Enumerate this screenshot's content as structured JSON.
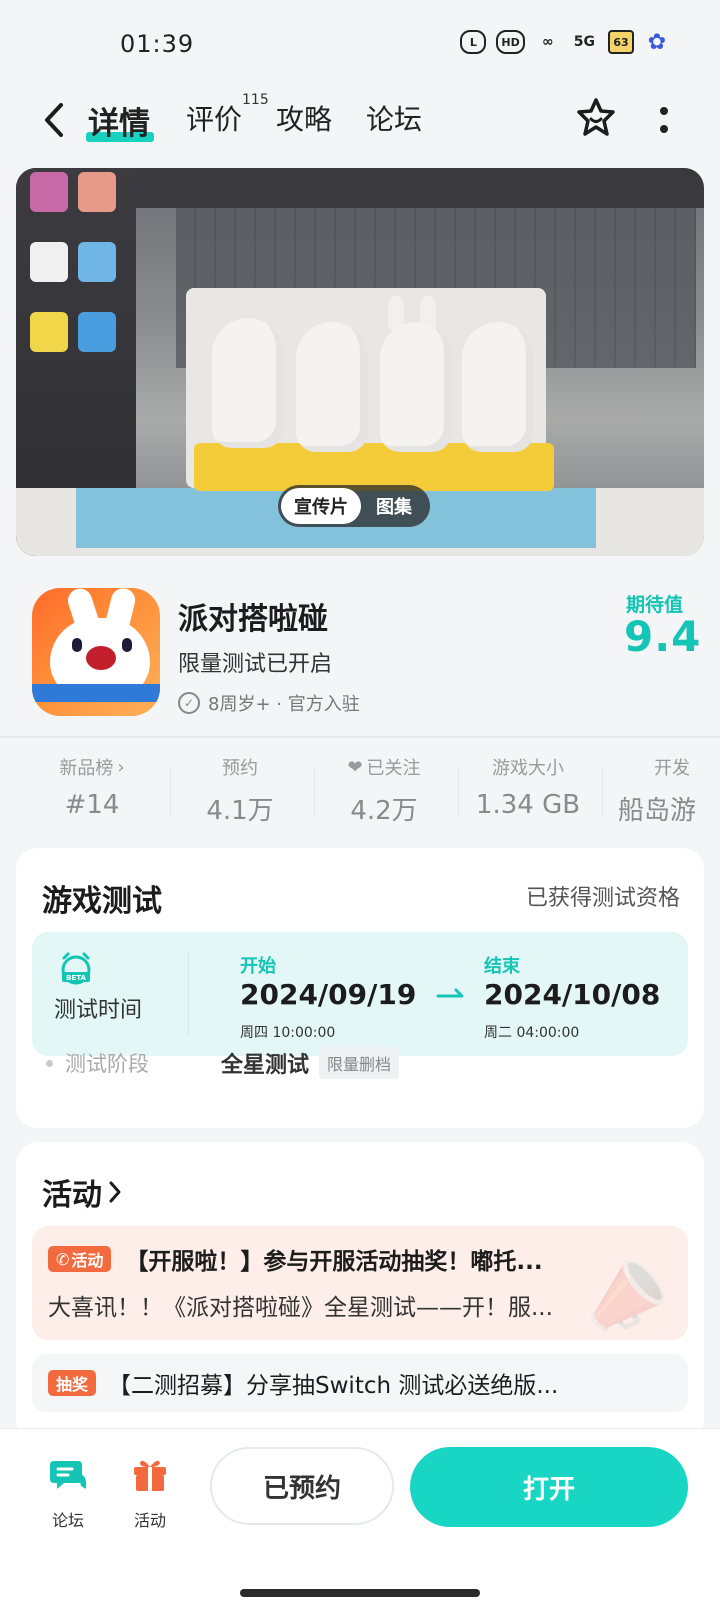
{
  "status_bar": {
    "time": "01:39",
    "icons": [
      "cat-icon",
      "hd-icon",
      "loop-icon",
      "5g-signal-icon",
      "battery-icon",
      "flower-icon"
    ],
    "hd_label": "HD",
    "net_label": "5G",
    "battery_label": "63",
    "cat_label": "L"
  },
  "nav": {
    "tabs": [
      {
        "label": "详情",
        "active": true
      },
      {
        "label": "评价"
      },
      {
        "label": "攻略"
      },
      {
        "label": "论坛"
      }
    ],
    "review_count": "115"
  },
  "hero": {
    "toggle_active": "宣传片",
    "toggle_inactive": "图集"
  },
  "game": {
    "title": "派对搭啦碰",
    "subtitle": "限量测试已开启",
    "meta": "8周岁+ · 官方入驻",
    "expect_label": "期待值",
    "expect_score": "9.4"
  },
  "stats": [
    {
      "label": "新品榜",
      "value": "#14"
    },
    {
      "label": "预约",
      "value": "4.1万"
    },
    {
      "label": "已关注",
      "value": "4.2万"
    },
    {
      "label": "游戏大小",
      "value": "1.34 GB"
    },
    {
      "label": "开发",
      "value": "船岛游"
    }
  ],
  "test": {
    "title": "游戏测试",
    "qualified": "已获得测试资格",
    "time_label": "测试时间",
    "start_label": "开始",
    "start_date": "2024/09/19",
    "start_time": "周四  10:00:00",
    "end_label": "结束",
    "end_date": "2024/10/08",
    "end_time": "周二  04:00:00",
    "stage_label": "测试阶段",
    "stage_value": "全星测试",
    "stage_tag": "限量删档",
    "beta_text": "BETA"
  },
  "activity": {
    "title": "活动",
    "items": [
      {
        "badge": "活动",
        "headline": "【开服啦！】参与开服活动抽奖！嘟托...",
        "desc": "大喜讯！！《派对搭啦碰》全星测试——开！服..."
      },
      {
        "badge": "抽奖",
        "headline": "【二测招募】分享抽Switch 测试必送绝版..."
      }
    ]
  },
  "bottom": {
    "forum_label": "论坛",
    "activity_label": "活动",
    "reserved_label": "已预约",
    "open_label": "打开"
  },
  "colors": {
    "accent": "#19D6C4",
    "activity_badge": "#F26A3E",
    "test_box_bg": "#E3F8F6"
  }
}
